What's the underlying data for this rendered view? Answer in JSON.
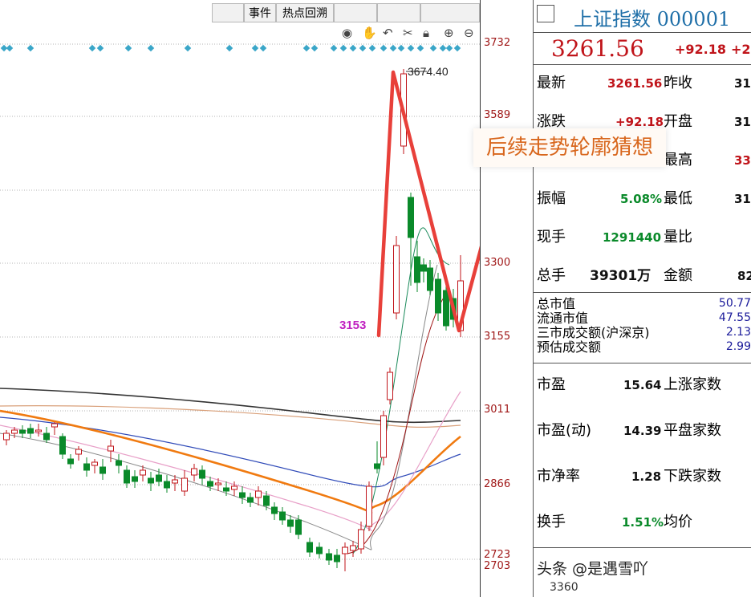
{
  "toolbar": {
    "tabs": [
      {
        "label": "事件"
      },
      {
        "label": "热点回溯"
      }
    ],
    "icons": [
      "eye-icon",
      "hand-icon",
      "undo-icon",
      "scissors-icon",
      "lock-icon",
      "zoom-in-icon",
      "zoom-out-icon"
    ]
  },
  "chart": {
    "high_label": "3674.40",
    "low_marker": "3153",
    "y_axis": [
      "3732",
      "3589",
      "3300",
      "3155",
      "3011",
      "2866",
      "2723",
      "2703"
    ],
    "callout": "后续走势轮廓猜想"
  },
  "panel": {
    "title": "上证指数 000001",
    "price": "3261.56",
    "change": "+92.18",
    "change_pct": "+2.",
    "rows": [
      {
        "label": "最新",
        "value": "3261.56",
        "label2": "昨收",
        "value2": "31"
      },
      {
        "label": "涨跌",
        "value": "+92.18",
        "label2": "开盘",
        "value2": "31"
      },
      {
        "label": "",
        "value": "",
        "label2": "最高",
        "value2": "33"
      },
      {
        "label": "振幅",
        "value": "5.08%",
        "label2": "最低",
        "value2": "31"
      },
      {
        "label": "现手",
        "value": "1291440",
        "label2": "量比",
        "value2": ""
      },
      {
        "label": "总手",
        "value": "39301万",
        "label2": "金额",
        "value2": "82"
      }
    ],
    "small_rows": [
      {
        "label": "总市值",
        "value": "50.77"
      },
      {
        "label": "流通市值",
        "value": "47.55"
      },
      {
        "label": "三市成交额(沪深京)",
        "value": "2.13"
      },
      {
        "label": "预估成交额",
        "value": "2.99"
      }
    ],
    "metrics": [
      {
        "label": "市盈",
        "value": "15.64",
        "label2": "上涨家数"
      },
      {
        "label": "市盈(动)",
        "value": "14.39",
        "label2": "平盘家数"
      },
      {
        "label": "市净率",
        "value": "1.28",
        "label2": "下跌家数"
      },
      {
        "label": "换手",
        "value": "1.51%",
        "label2": "均价"
      }
    ],
    "bottom_left": "3360",
    "watermark": "头条 @是遇雪吖"
  },
  "colors": {
    "up": "#c0141a",
    "down": "#0a8a2a",
    "sketch": "#e8403a",
    "callout_text": "#d8661c",
    "diamond": "#3aa6c8"
  }
}
